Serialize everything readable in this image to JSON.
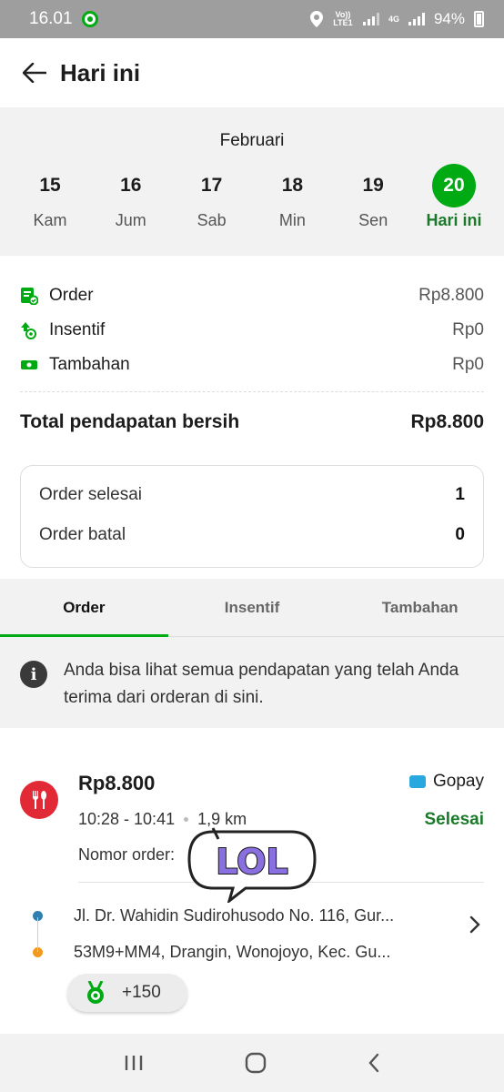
{
  "status_bar": {
    "time": "16.01",
    "network_1": "Vo)) LTE1",
    "network_2": "4G",
    "battery": "94%"
  },
  "header": {
    "title": "Hari ini"
  },
  "date_strip": {
    "month": "Februari",
    "days": [
      {
        "num": "15",
        "name": "Kam"
      },
      {
        "num": "16",
        "name": "Jum"
      },
      {
        "num": "17",
        "name": "Sab"
      },
      {
        "num": "18",
        "name": "Min"
      },
      {
        "num": "19",
        "name": "Sen"
      },
      {
        "num": "20",
        "name": "Hari ini",
        "active": true
      }
    ]
  },
  "earnings": {
    "rows": [
      {
        "label": "Order",
        "value": "Rp8.800",
        "icon": "order-receipt-icon"
      },
      {
        "label": "Insentif",
        "value": "Rp0",
        "icon": "incentive-arrow-icon"
      },
      {
        "label": "Tambahan",
        "value": "Rp0",
        "icon": "cash-icon"
      }
    ],
    "total_label": "Total pendapatan bersih",
    "total_value": "Rp8.800"
  },
  "summary": {
    "completed_label": "Order selesai",
    "completed_value": "1",
    "cancelled_label": "Order batal",
    "cancelled_value": "0"
  },
  "tabs": [
    {
      "label": "Order",
      "active": true
    },
    {
      "label": "Insentif"
    },
    {
      "label": "Tambahan"
    }
  ],
  "info_text": "Anda bisa lihat semua pendapatan yang telah Anda terima dari orderan di sini.",
  "order": {
    "amount": "Rp8.800",
    "payment": "Gopay",
    "time_range": "10:28 - 10:41",
    "distance": "1,9 km",
    "status": "Selesai",
    "order_number_label": "Nomor order:",
    "pickup": "Jl. Dr. Wahidin Sudirohusodo No. 116, Gur...",
    "dropoff": "53M9+MM4, Drangin, Wonojoyo, Kec. Gu...",
    "bonus": "+150"
  },
  "sticker": {
    "text": "LOL"
  },
  "colors": {
    "brand_green": "#00aa13",
    "status_green": "#1b7a2a",
    "food_red": "#e22a36",
    "gopay_blue": "#29a8e0"
  }
}
